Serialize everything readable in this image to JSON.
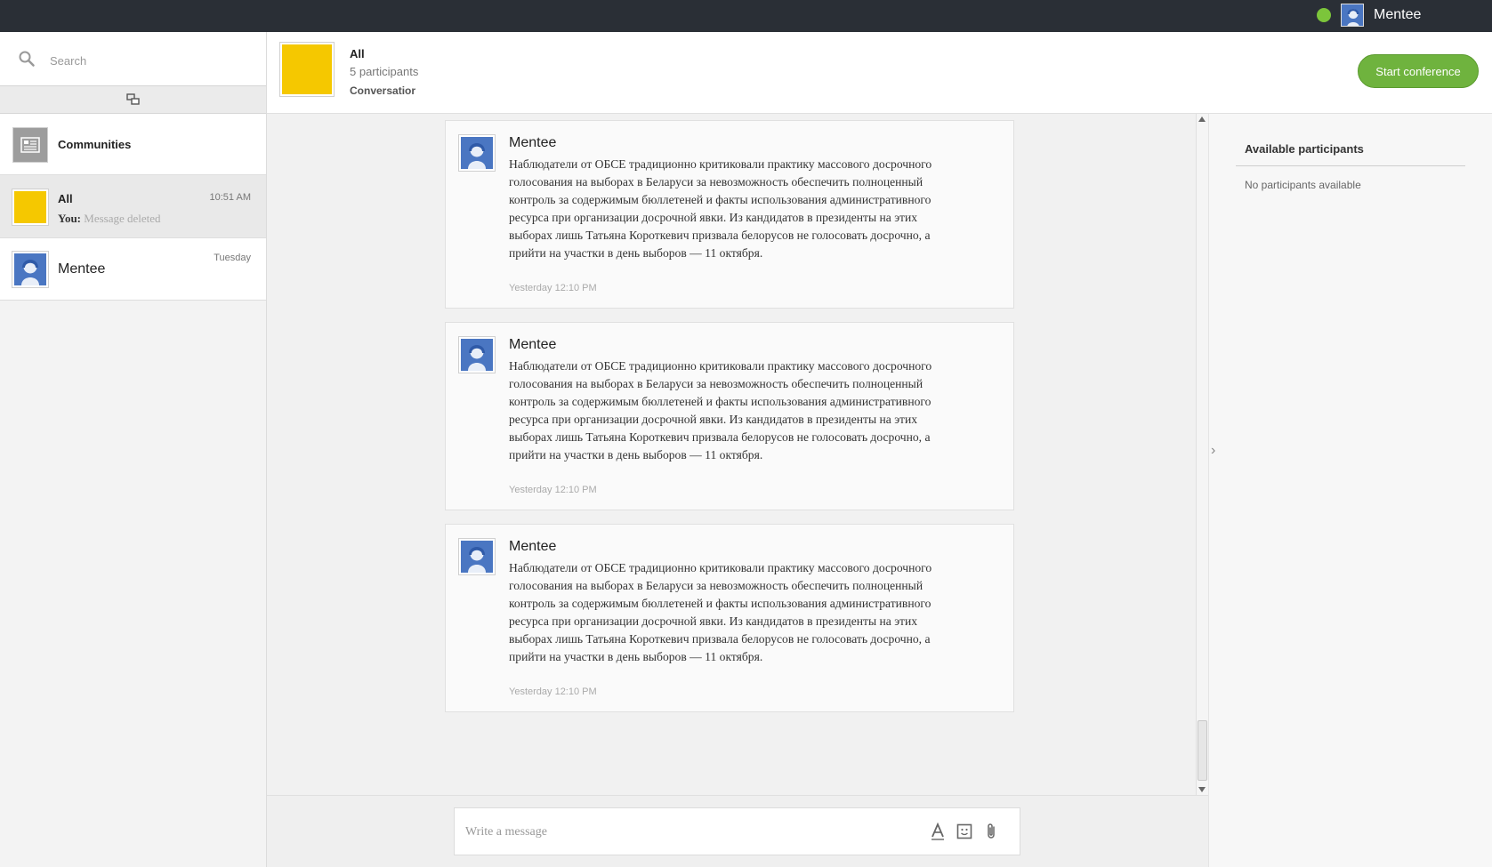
{
  "topbar": {
    "user_name": "Mentee",
    "status": "online",
    "status_color": "#7cc53b"
  },
  "sidebar": {
    "search_placeholder": "Search",
    "conversations": [
      {
        "title": "Communities",
        "icon": "communities-icon"
      },
      {
        "title": "All",
        "time": "10:51 AM",
        "preview_prefix": "You:",
        "preview_text": "Message deleted",
        "thumb_color": "#f5c800"
      },
      {
        "title": "Mentee",
        "time": "Tuesday"
      }
    ]
  },
  "chat": {
    "title": "All",
    "participants": "5 participants",
    "type": "Conversatior",
    "start_conference_label": "Start conference",
    "accent_color": "#6fb33e"
  },
  "messages": [
    {
      "author": "Mentee",
      "text": "Наблюдатели от ОБСЕ традиционно критиковали практику массового досрочного голосования на выборах в Беларуси за невозможность обеспечить полноценный контроль за содержимым бюллетеней и факты использования административного ресурса при организации досрочной явки. Из кандидатов в президенты на этих выборах лишь Татьяна Короткевич призвала белорусов не голосовать досрочно, а прийти на участки в день выборов — 11 октября.",
      "time": "Yesterday 12:10 PM"
    },
    {
      "author": "Mentee",
      "text": "Наблюдатели от ОБСЕ традиционно критиковали практику массового досрочного голосования на выборах в Беларуси за невозможность обеспечить полноценный контроль за содержимым бюллетеней и факты использования административного ресурса при организации досрочной явки. Из кандидатов в президенты на этих выборах лишь Татьяна Короткевич призвала белорусов не голосовать досрочно, а прийти на участки в день выборов — 11 октября.",
      "time": "Yesterday 12:10 PM"
    },
    {
      "author": "Mentee",
      "text": "Наблюдатели от ОБСЕ традиционно критиковали практику массового досрочного голосования на выборах в Беларуси за невозможность обеспечить полноценный контроль за содержимым бюллетеней и факты использования административного ресурса при организации досрочной явки. Из кандидатов в президенты на этих выборах лишь Татьяна Короткевич призвала белорусов не голосовать досрочно, а прийти на участки в день выборов — 11 октября.",
      "time": "Yesterday 12:10 PM"
    }
  ],
  "right_panel": {
    "title": "Available participants",
    "empty_text": "No participants available"
  },
  "composer": {
    "placeholder": "Write a message",
    "tools": [
      "text-format-icon",
      "emoji-icon",
      "attach-icon"
    ]
  }
}
